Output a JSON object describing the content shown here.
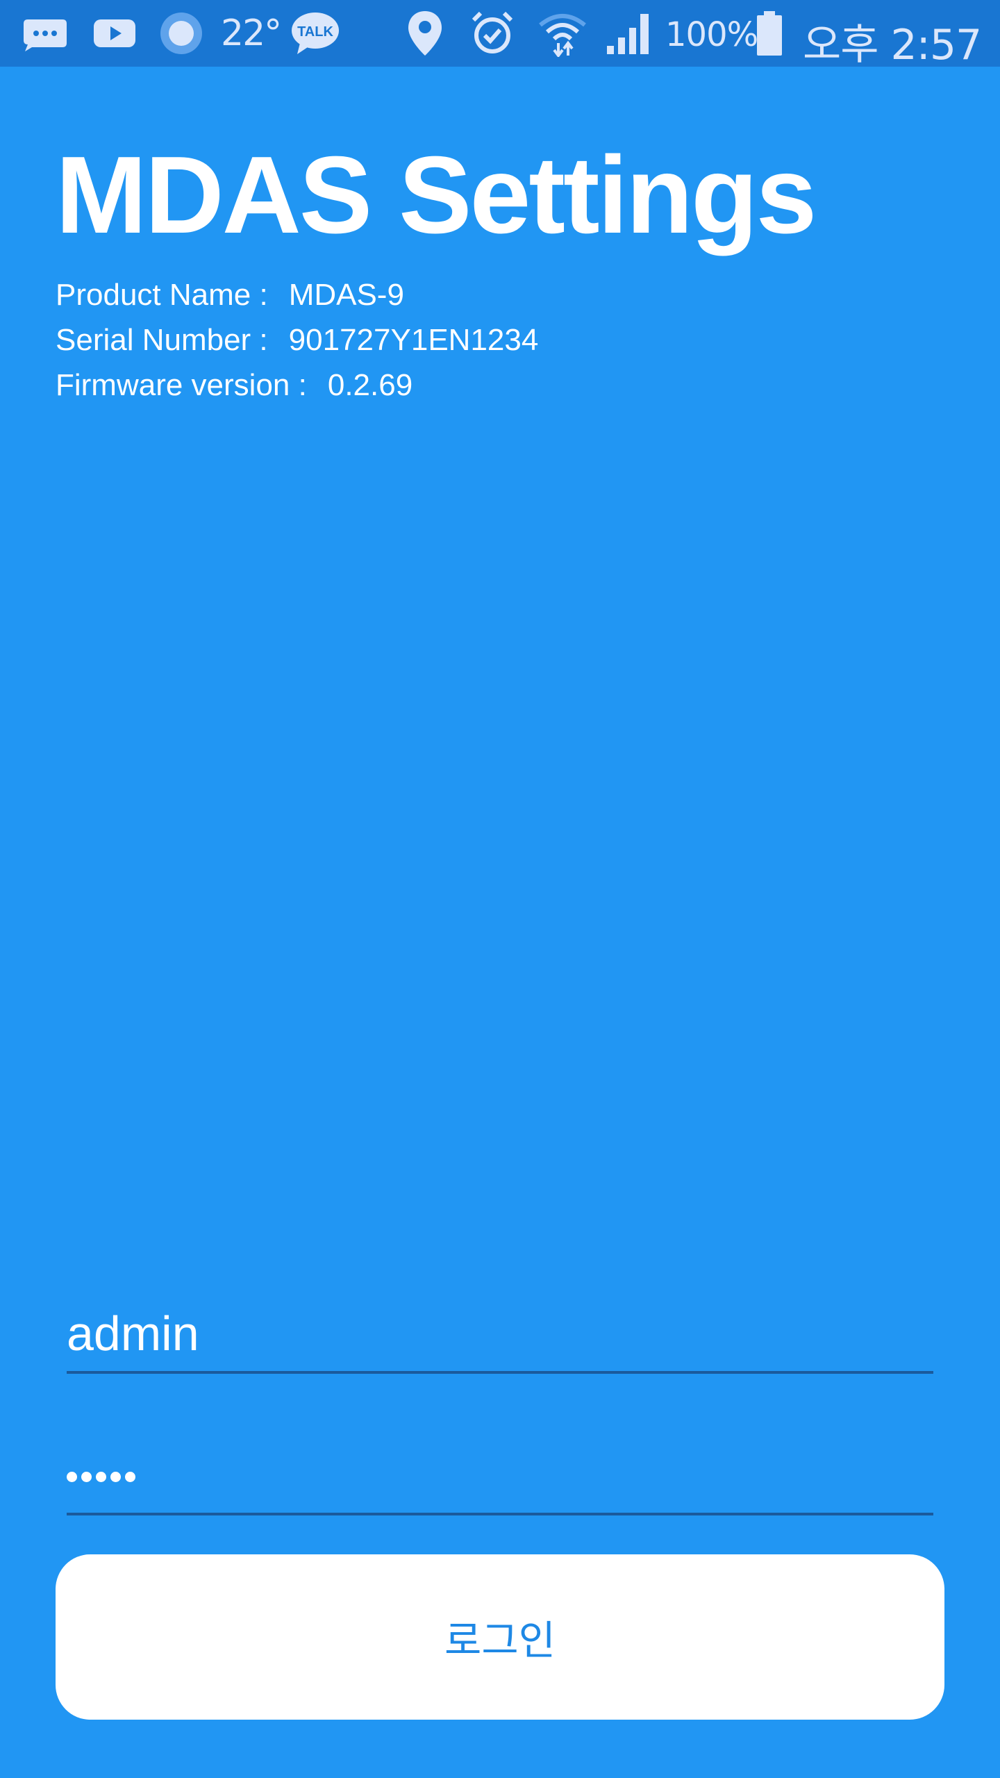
{
  "status_bar": {
    "icons": [
      "chat-bubble-icon",
      "youtube-icon",
      "circle-dot-icon",
      "kakaotalk-icon",
      "location-pin-icon",
      "alarm-icon",
      "wifi-icon",
      "cell-signal-icon",
      "battery-icon"
    ],
    "temperature": "22°",
    "talk_label": "TALK",
    "battery": "100%",
    "time": "오후 2:57"
  },
  "header": {
    "title": "MDAS Settings",
    "info": [
      {
        "label": "Product Name :",
        "value": "MDAS-9"
      },
      {
        "label": "Serial Number :",
        "value": "901727Y1EN1234"
      },
      {
        "label": "Firmware version :",
        "value": "0.2.69"
      }
    ]
  },
  "login": {
    "username_value": "admin",
    "password_length": 5,
    "button_label": "로그인"
  },
  "colors": {
    "background": "#2196F3",
    "status_bar": "#1976D2",
    "button_text": "#1E88E5",
    "underline": "#1a5a9c"
  }
}
